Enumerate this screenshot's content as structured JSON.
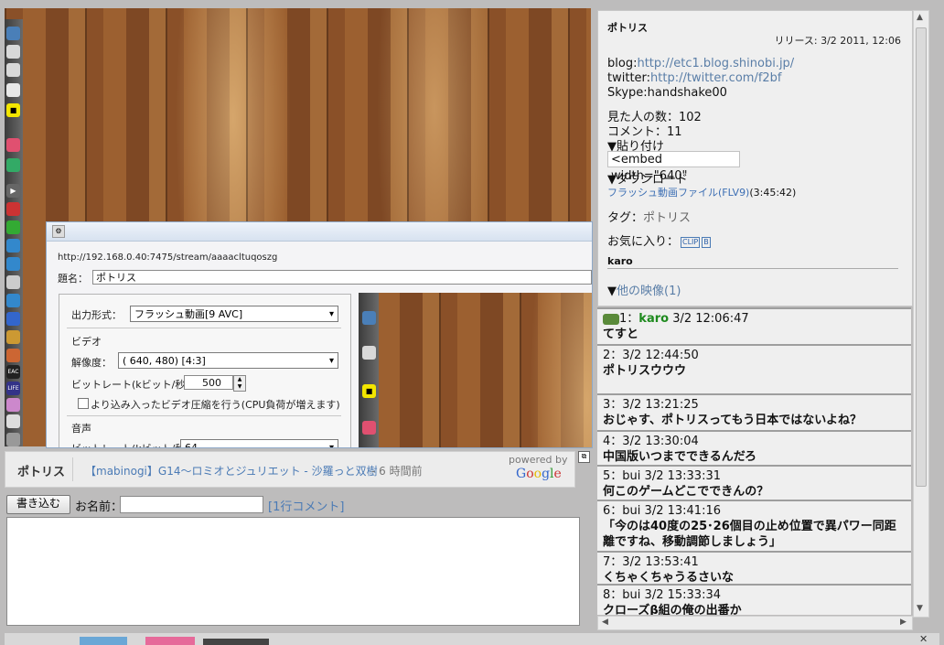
{
  "video": {
    "dock_icons": [
      "app",
      "app",
      "app",
      "app",
      "app",
      "app",
      "app",
      "app",
      "app",
      "app",
      "app",
      "app",
      "app",
      "app",
      "app",
      "app",
      "app",
      "app",
      "app",
      "app",
      "app",
      "app",
      "app",
      "app",
      "app"
    ],
    "dock_labels": {
      "eac": "EAC",
      "life": "LIFE"
    }
  },
  "subwindow": {
    "url": "http://192.168.0.40:7475/stream/aaaacltuqoszg",
    "title_label": "題名：",
    "title_value": "ポトリス",
    "output_label": "出力形式：",
    "output_value": "フラッシュ動画[9 AVC]",
    "video_section": "ビデオ",
    "resolution_label": "解像度：",
    "resolution_value": "( 640, 480) [4:3]",
    "bitrate_label": "ビットレート(kビット/秒)：",
    "bitrate_value": "500",
    "compress_label": "より込み入ったビデオ圧縮を行う(CPU負荷が増えます)",
    "audio_section": "音声",
    "audio_bitrate_label": "ビットレート(kビット/秒)：",
    "audio_bitrate_value": "64"
  },
  "infobar": {
    "title": "ポトリス",
    "related_link": "【mabinogi】G14～ロミオとジュリエット - 沙羅っと双樹",
    "time_ago": "- 6 時間前",
    "powered_by": "powered by",
    "google": "Google"
  },
  "comment_form": {
    "submit_label": "書き込む",
    "name_label": "お名前：",
    "name_value": "",
    "oneline_link": "[1行コメント]"
  },
  "info_panel": {
    "title": "ポトリス",
    "release": "リリース: 3/2 2011, 12:06",
    "blog_label": "blog:",
    "blog_url": "http://etc1.blog.shinobi.jp/",
    "twitter_label": "twitter:",
    "twitter_url": "http://twitter.com/f2bf",
    "skype": "Skype:handshake00",
    "viewers": "見た人の数：102",
    "comments": "コメント：11",
    "paste_label": "▼貼り付け",
    "embed_code": "<embed width=\"640\"",
    "download_label": "▼ダウンロード",
    "download_file_link": "フラッシュ動画ファイル(FLV9)",
    "download_file_len": "(3:45:42)",
    "tag_label": "タグ：",
    "tag_value": "ポトリス",
    "favorite_label": "お気に入り：",
    "clip_badge": "CLIP",
    "b_badge": "B",
    "user": "karo",
    "other_videos_prefix": "▼",
    "other_videos": "他の映像(1)"
  },
  "comments": [
    {
      "num": "1",
      "user": "karo",
      "time": "3/2 12:06:47",
      "text": "てすと"
    },
    {
      "num": "2",
      "user": "",
      "time": "3/2 12:44:50",
      "text": "ポトリスウウウ"
    },
    {
      "num": "3",
      "user": "",
      "time": "3/2 13:21:25",
      "text": "おじゃす、ポトリスってもう日本ではないよね？"
    },
    {
      "num": "4",
      "user": "",
      "time": "3/2 13:30:04",
      "text": "中国版いつまでできるんだろ"
    },
    {
      "num": "5",
      "user": "bui",
      "time": "3/2 13:33:31",
      "text": "何このゲームどこでできんの？"
    },
    {
      "num": "6",
      "user": "bui",
      "time": "3/2 13:41:16",
      "text": "「今のは40度の25･26個目の止め位置で異パワー同距離ですね、移動調節しましょう」"
    },
    {
      "num": "7",
      "user": "",
      "time": "3/2 13:53:41",
      "text": "くちゃくちゃうるさいな"
    },
    {
      "num": "8",
      "user": "bui",
      "time": "3/2 15:33:34",
      "text": "クローズβ組の俺の出番か"
    }
  ],
  "colors": {
    "link": "#4a7ab5",
    "accent_green": "#1e8a1e",
    "panel_bg": "#efefef",
    "page_bg": "#bdbcbc"
  }
}
